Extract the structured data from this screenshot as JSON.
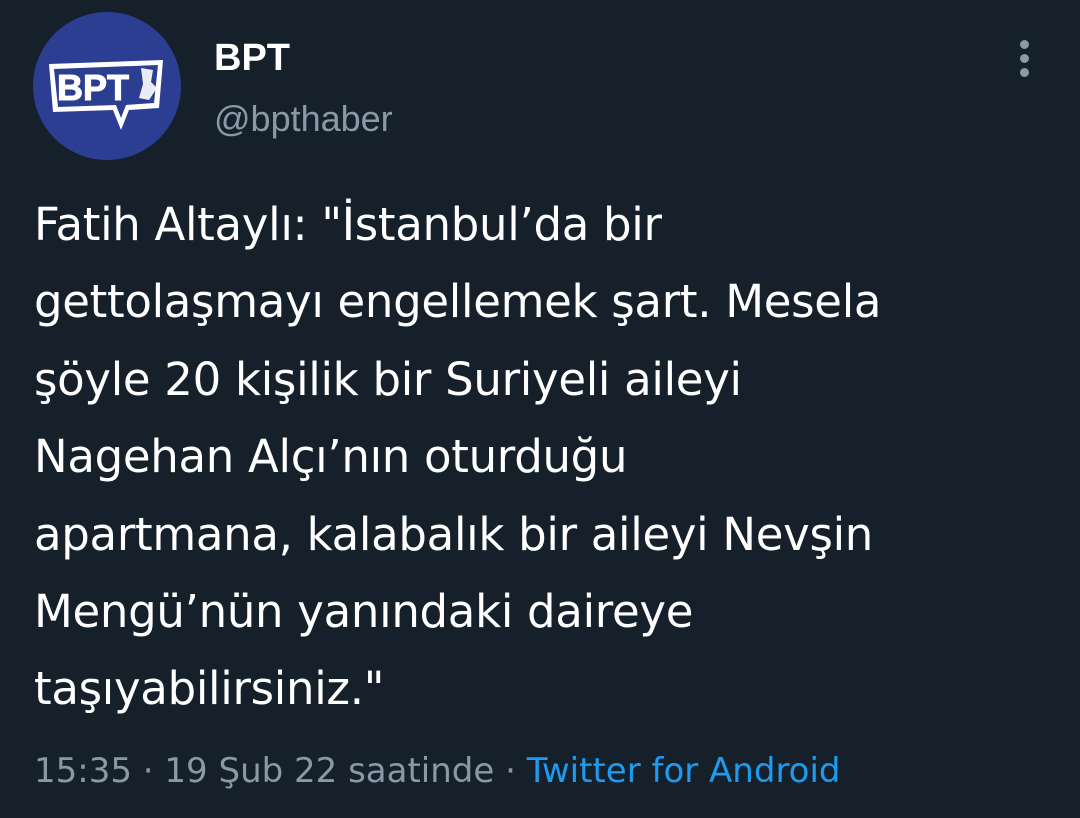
{
  "author": {
    "name": "BPT",
    "handle": "@bpthaber",
    "avatar_text": "BPT",
    "avatar_color": "#2b3e91"
  },
  "more_icon": "vertical-ellipsis-icon",
  "tweet": {
    "lines": [
      "Fatih Altaylı: \"İstanbul’da bir",
      "gettolaşmayı engellemek şart. Mesela",
      "şöyle 20 kişilik bir Suriyeli aileyi",
      "Nagehan Alçı’nın oturduğu",
      "apartmana, kalabalık bir aileyi Nevşin",
      "Mengü’nün yanındaki daireye",
      "taşıyabilirsiniz.\""
    ]
  },
  "meta": {
    "time": "15:35",
    "separator": " · ",
    "date": "19 Şub 22 saatinde",
    "source": "Twitter for Android"
  },
  "colors": {
    "background": "#15202b",
    "text": "#ffffff",
    "secondary": "#8b98a5",
    "link": "#1d9bf0"
  }
}
